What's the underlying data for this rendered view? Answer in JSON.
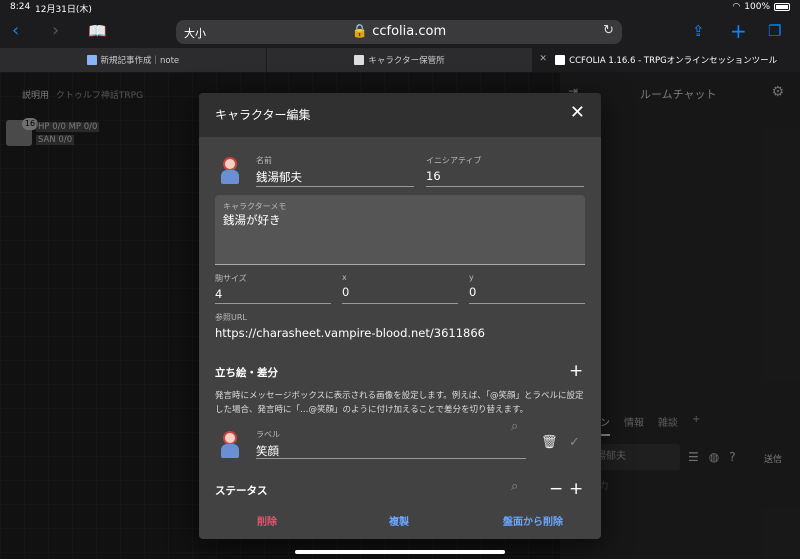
{
  "status": {
    "time": "8:24",
    "date": "12月31日(木)",
    "battery": "100%"
  },
  "browser": {
    "text_size": "大小",
    "url": "ccfolia.com",
    "tabs": [
      {
        "label": "新規記事作成｜note"
      },
      {
        "label": "キャラクター保管所"
      },
      {
        "label": "CCFOLIA 1.16.6 - TRPGオンラインセッションツール"
      }
    ]
  },
  "scene": {
    "title": "説明用",
    "subtitle": "クトゥルフ神話TRPG"
  },
  "board_char": {
    "initiative": "16",
    "stats": [
      {
        "text": "HP      0/0   MP      0/0"
      },
      {
        "text": "SAN      0/0"
      }
    ]
  },
  "chat": {
    "title": "ルームチャット",
    "tabs": [
      "メイン",
      "情報",
      "雑談",
      "+"
    ],
    "name": "銭湯郁夫",
    "send": "送信",
    "placeholder": "を入力"
  },
  "dialog": {
    "title": "キャラクター編集",
    "name_label": "名前",
    "name_value": "銭湯郁夫",
    "init_label": "イニシアティブ",
    "init_value": "16",
    "memo_label": "キャラクターメモ",
    "memo_value": "銭湯が好き",
    "size_label": "駒サイズ",
    "size_value": "4",
    "x_label": "x",
    "x_value": "0",
    "y_label": "y",
    "y_value": "0",
    "url_label": "参照URL",
    "url_value": "https://charasheet.vampire-blood.net/3611866",
    "portrait_title": "立ち絵・差分",
    "portrait_desc": "発言時にメッセージボックスに表示される画像を設定します。例えば、「@笑顔」とラベルに設定した場合、発言時に「…@笑顔」のように付け加えることで差分を切り替えます。",
    "diff_label_label": "ラベル",
    "diff_label_value": "笑顔",
    "status_title": "ステータス",
    "delete": "削除",
    "duplicate": "複製",
    "remove_from_board": "盤面から削除"
  },
  "colors": {
    "delete": "#e05570",
    "primary": "#6aa6ff",
    "accent": "#0a84ff"
  }
}
